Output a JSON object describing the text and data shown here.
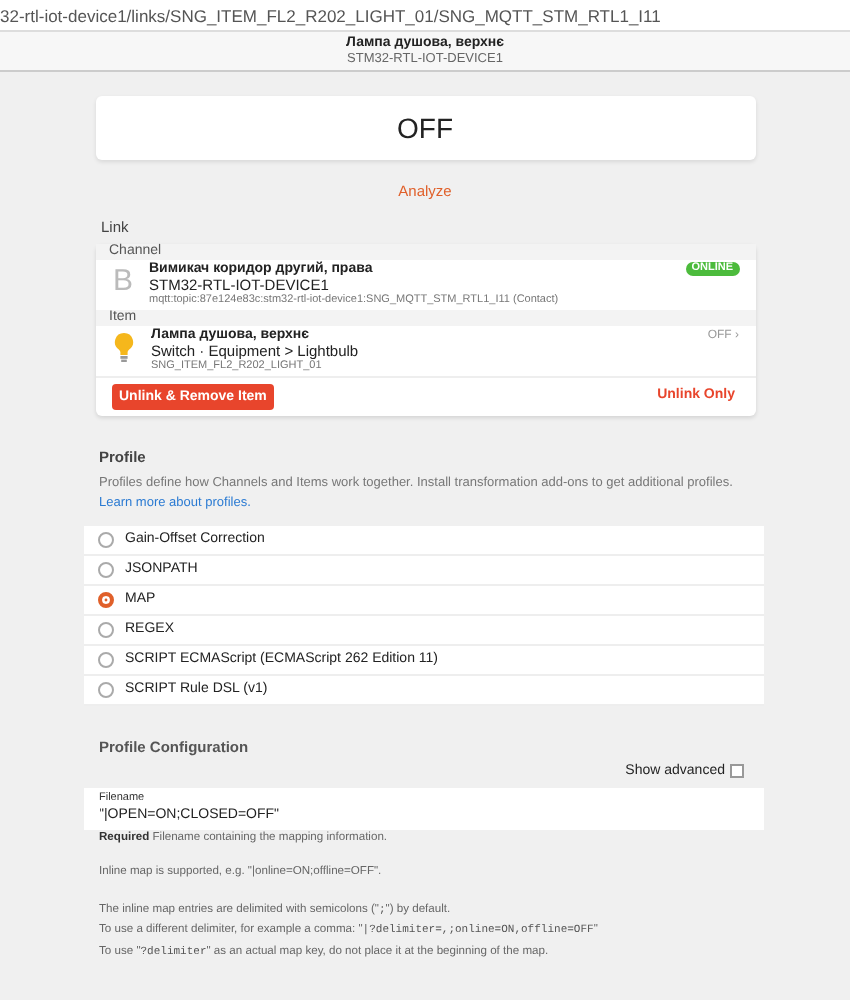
{
  "address_bar": {
    "url": "32-rtl-iot-device1/links/SNG_ITEM_FL2_R202_LIGHT_01/SNG_MQTT_STM_RTL1_I11"
  },
  "header": {
    "title": "Лампа душова, верхнє",
    "subtitle": "STM32-RTL-IOT-DEVICE1"
  },
  "state_card": {
    "value": "OFF"
  },
  "analyze_link": "Analyze",
  "link": {
    "label": "Link",
    "channel": {
      "section": "Channel",
      "letter": "B",
      "name": "Вимикач коридор другий, права",
      "thing": "STM32-RTL-IOT-DEVICE1",
      "uid": "mqtt:topic:87e124e83c:stm32-rtl-iot-device1:SNG_MQTT_STM_RTL1_I11 (Contact)",
      "status": "ONLINE"
    },
    "item": {
      "section": "Item",
      "name": "Лампа душова, верхнє",
      "type": "Switch · Equipment > Lightbulb",
      "id": "SNG_ITEM_FL2_R202_LIGHT_01",
      "state": "OFF",
      "chevron": "›"
    },
    "buttons": [
      {
        "label": "Unlink & Remove Item",
        "kind": "filled"
      },
      {
        "label": "Unlink Only",
        "kind": "text"
      }
    ]
  },
  "profile": {
    "title": "Profile",
    "description": "Profiles define how Channels and Items work together. Install transformation add-ons to get additional profiles.",
    "learn_more": "Learn more about profiles.",
    "options": [
      {
        "label": "Gain-Offset Correction",
        "selected": false
      },
      {
        "label": "JSONPATH",
        "selected": false
      },
      {
        "label": "MAP",
        "selected": true
      },
      {
        "label": "REGEX",
        "selected": false
      },
      {
        "label": "SCRIPT ECMAScript (ECMAScript 262 Edition 11)",
        "selected": false
      },
      {
        "label": "SCRIPT Rule DSL (v1)",
        "selected": false
      }
    ]
  },
  "configuration": {
    "title": "Profile Configuration",
    "show_advanced": {
      "label": "Show advanced",
      "checked": false
    },
    "field": {
      "label": "Filename",
      "value": "\"|OPEN=ON;CLOSED=OFF\""
    },
    "help": [
      [
        {
          "text": "**Required** Filename containing the mapping information.",
          "code": false
        }
      ],
      [
        {
          "text": "Inline map is supported, e.g. \"|online=ON;offline=OFF\".",
          "code": false
        }
      ],
      [
        {
          "text": "The inline map entries are delimited with semicolons (\"",
          "code": false
        },
        {
          "text": ";",
          "code": true
        },
        {
          "text": "\") by default.",
          "code": false
        }
      ],
      [
        {
          "text": "To use a different delimiter, for example a comma: \"",
          "code": false
        },
        {
          "text": "|?delimiter=,;online=ON,offline=OFF",
          "code": true
        },
        {
          "text": "\"",
          "code": false
        }
      ],
      [
        {
          "text": "To use \"",
          "code": false
        },
        {
          "text": "?delimiter",
          "code": true
        },
        {
          "text": "\" as an actual map key, do not place it at the beginning of the map.",
          "code": false
        }
      ]
    ]
  }
}
